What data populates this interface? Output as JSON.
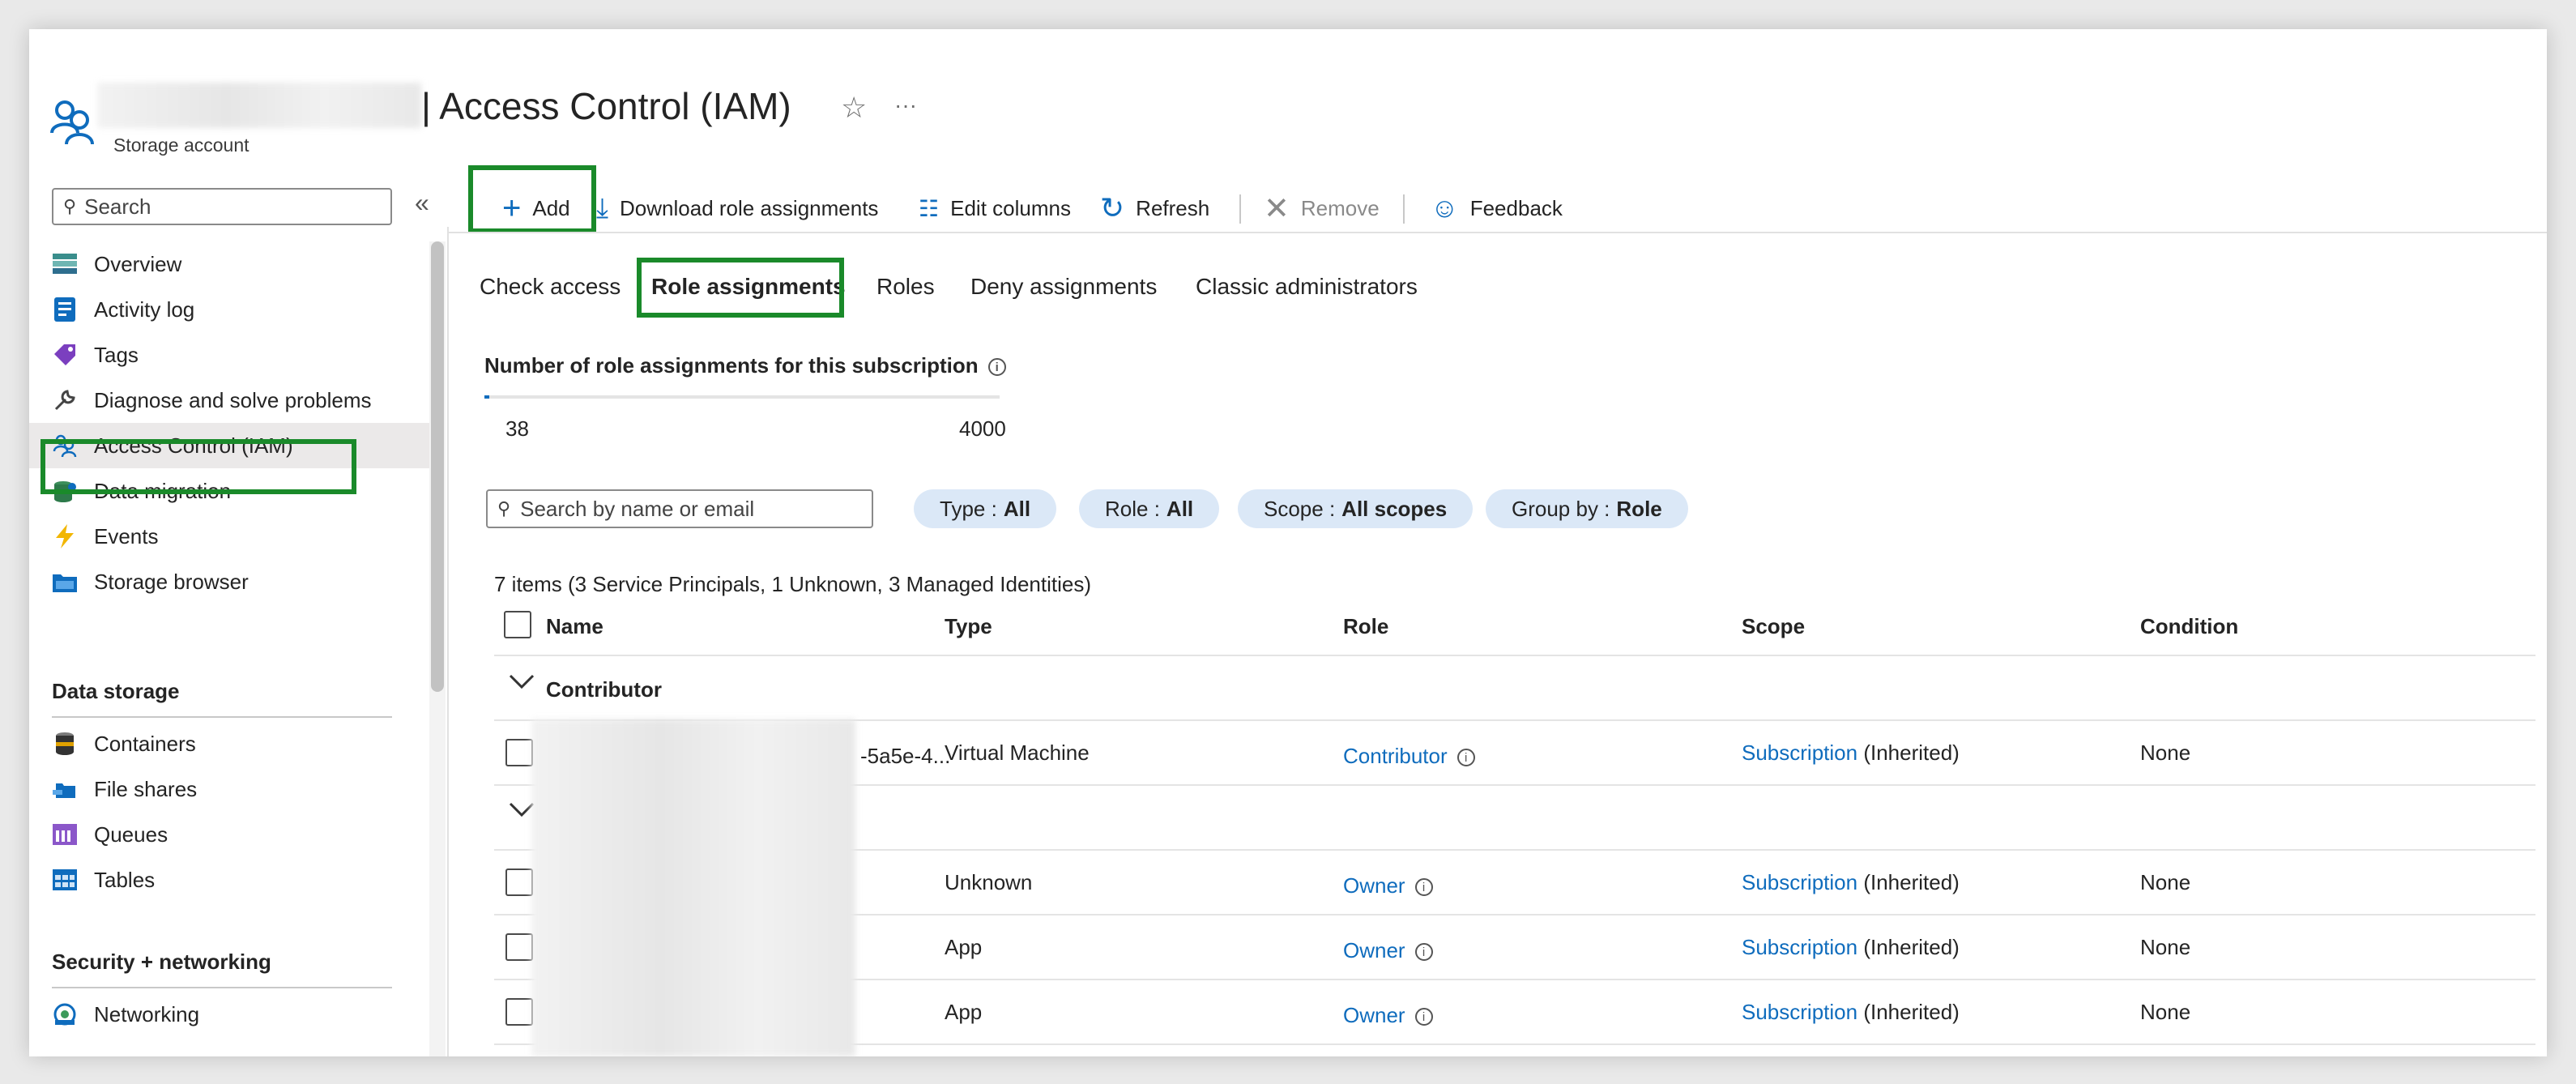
{
  "header": {
    "title": "| Access Control (IAM)",
    "subtitle": "Storage account",
    "star_icon": "☆",
    "more_icon": "···"
  },
  "sidebar": {
    "search_placeholder": "Search",
    "collapse_icon": "«",
    "items": [
      {
        "label": "Overview"
      },
      {
        "label": "Activity log"
      },
      {
        "label": "Tags"
      },
      {
        "label": "Diagnose and solve problems"
      },
      {
        "label": "Access Control (IAM)"
      },
      {
        "label": "Data migration"
      },
      {
        "label": "Events"
      },
      {
        "label": "Storage browser"
      }
    ],
    "section_data_storage": "Data storage",
    "data_storage_items": [
      {
        "label": "Containers"
      },
      {
        "label": "File shares"
      },
      {
        "label": "Queues"
      },
      {
        "label": "Tables"
      }
    ],
    "section_security": "Security + networking",
    "security_items": [
      {
        "label": "Networking"
      }
    ]
  },
  "toolbar": {
    "add": "Add",
    "download": "Download role assignments",
    "edit_columns": "Edit columns",
    "refresh": "Refresh",
    "remove": "Remove",
    "feedback": "Feedback"
  },
  "tabs": [
    "Check access",
    "Role assignments",
    "Roles",
    "Deny assignments",
    "Classic administrators"
  ],
  "quota": {
    "label": "Number of role assignments for this subscription",
    "current": "38",
    "max": "4000",
    "progress_fraction": 0.0095
  },
  "filters": {
    "search_placeholder": "Search by name or email",
    "type_label": "Type :",
    "type_value": "All",
    "role_label": "Role :",
    "role_value": "All",
    "scope_label": "Scope :",
    "scope_value": "All scopes",
    "group_label": "Group by :",
    "group_value": "Role"
  },
  "table": {
    "summary": "7 items (3 Service Principals, 1 Unknown, 3 Managed Identities)",
    "columns": [
      "Name",
      "Type",
      "Role",
      "Scope",
      "Condition"
    ],
    "group_contributor": "Contributor",
    "rows": [
      {
        "name_suffix": "-5a5e-4...",
        "type": "Virtual Machine",
        "role": "Contributor",
        "scope_link": "Subscription",
        "scope_note": "(Inherited)",
        "condition": "None"
      },
      {
        "name_suffix": "",
        "type": "Unknown",
        "role": "Owner",
        "scope_link": "Subscription",
        "scope_note": "(Inherited)",
        "condition": "None"
      },
      {
        "name_suffix": "",
        "type": "App",
        "role": "Owner",
        "scope_link": "Subscription",
        "scope_note": "(Inherited)",
        "condition": "None"
      },
      {
        "name_suffix": "",
        "type": "App",
        "role": "Owner",
        "scope_link": "Subscription",
        "scope_note": "(Inherited)",
        "condition": "None"
      }
    ]
  },
  "colors": {
    "accent": "#0f6cbd",
    "highlight_box": "#1a8a2a",
    "pill_bg": "#dbe8f7"
  }
}
